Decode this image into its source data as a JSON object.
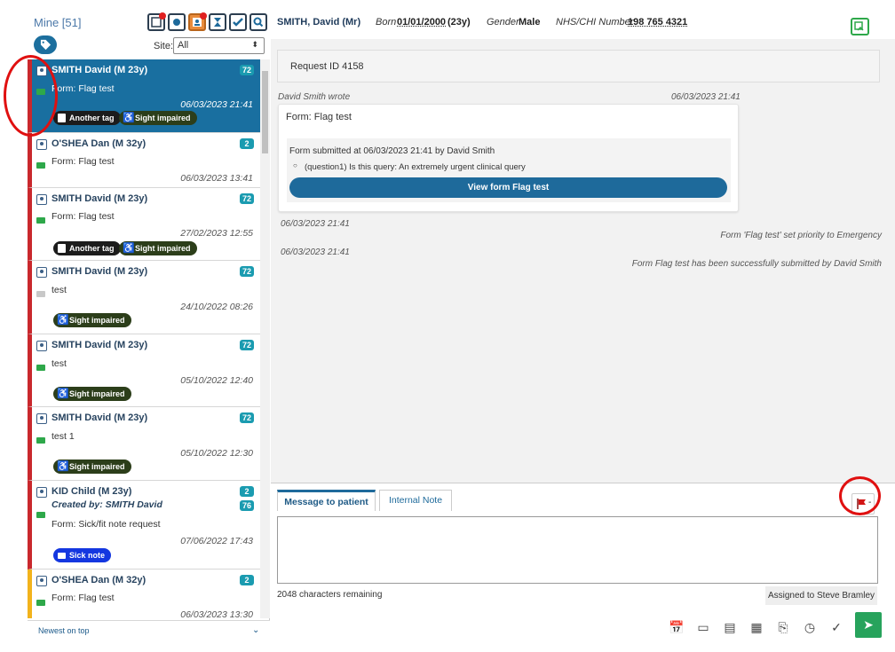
{
  "left": {
    "title": "Mine [51]",
    "site_label": "Site:",
    "site_value": "All",
    "footer": "Newest on top",
    "toolbar_icons": [
      "flag-filter-icon",
      "circle-filter-icon",
      "user-filter-icon",
      "hourglass-filter-icon",
      "check-filter-icon",
      "search-filter-icon"
    ]
  },
  "list": [
    {
      "name": "SMITH David (M 23y)",
      "badge": "72",
      "sub": "Form: Flag test",
      "date": "06/03/2023 21:41",
      "tags": [
        "Another tag",
        "Sight impaired"
      ]
    },
    {
      "name": "O'SHEA Dan (M 32y)",
      "badge": "2",
      "sub": "Form: Flag test",
      "date": "06/03/2023 13:41",
      "tags": []
    },
    {
      "name": "SMITH David (M 23y)",
      "badge": "72",
      "sub": "Form: Flag test",
      "date": "27/02/2023 12:55",
      "tags": [
        "Another tag",
        "Sight impaired"
      ]
    },
    {
      "name": "SMITH David (M 23y)",
      "badge": "72",
      "sub": "test",
      "date": "24/10/2022 08:26",
      "tags": [
        "Sight impaired"
      ]
    },
    {
      "name": "SMITH David (M 23y)",
      "badge": "72",
      "sub": "test",
      "date": "05/10/2022 12:40",
      "tags": [
        "Sight impaired"
      ]
    },
    {
      "name": "SMITH David (M 23y)",
      "badge": "72",
      "sub": "test 1",
      "date": "05/10/2022 12:30",
      "tags": [
        "Sight impaired"
      ]
    },
    {
      "name": "KID Child (M 23y)",
      "badge": "2",
      "badge2": "76",
      "created": "Created by: SMITH David",
      "sub": "Form: Sick/fit note request",
      "date": "07/06/2022 17:43",
      "tags": [
        "Sick note"
      ]
    },
    {
      "name": "O'SHEA Dan (M 32y)",
      "badge": "2",
      "sub": "Form: Flag test",
      "date": "06/03/2023 13:30",
      "tags": []
    }
  ],
  "patient": {
    "name": "SMITH, David (Mr)",
    "born_label": "Born",
    "born": "01/01/2000",
    "age": "(23y)",
    "gender_label": "Gender",
    "gender": "Male",
    "nhs_label": "NHS/CHI Number",
    "nhs": "198 765 4321"
  },
  "request": {
    "label": "Request ID 4158"
  },
  "message": {
    "author": "David Smith wrote",
    "date": "06/03/2023 21:41",
    "title": "Form: Flag test",
    "submitted": "Form submitted at 06/03/2023 21:41 by David Smith",
    "question": "(question1) Is this query: An extremely urgent clinical query",
    "button": "View form Flag test"
  },
  "events": [
    {
      "date": "06/03/2023 21:41",
      "text": "Form 'Flag test' set priority to Emergency"
    },
    {
      "date": "06/03/2023 21:41",
      "text": "Form Flag test has been successfully submitted by David Smith"
    }
  ],
  "compose": {
    "tab1": "Message to patient",
    "tab2": "Internal Note",
    "flag_caret": "-",
    "chars": "2048 characters remaining",
    "assigned": "Assigned to Steve Bramley"
  },
  "colors": {
    "accent": "#1e6a9b",
    "selected": "#196fa0",
    "priority_red": "#c9282d",
    "priority_amber": "#f2b31c",
    "send": "#27a35c"
  }
}
